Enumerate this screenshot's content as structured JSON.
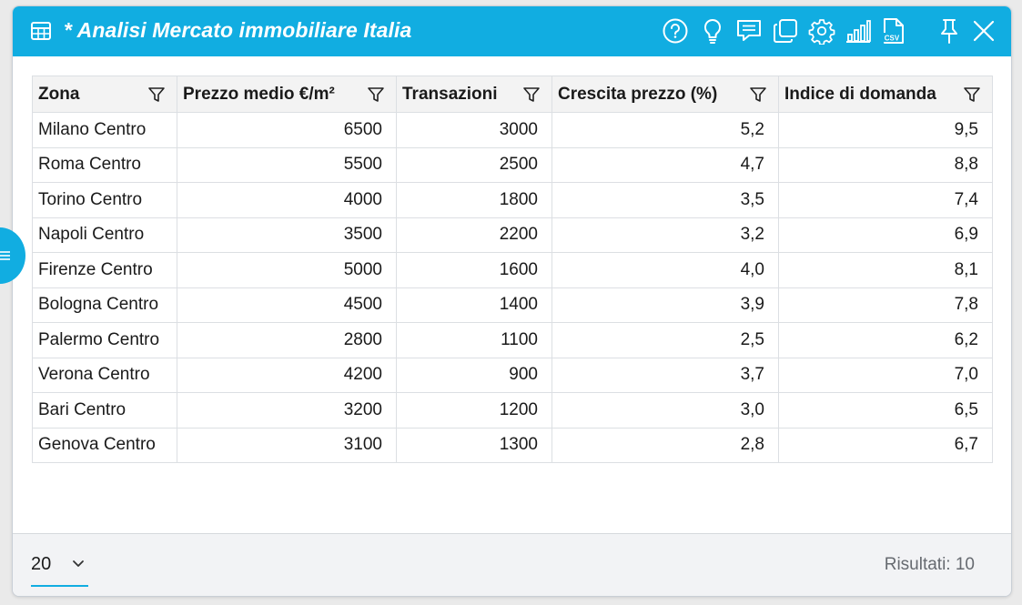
{
  "window": {
    "title": "* Analisi Mercato immobiliare Italia",
    "accent_color": "#11ade1"
  },
  "toolbar": {
    "icons": [
      "help-icon",
      "lightbulb-icon",
      "comment-icon",
      "duplicate-icon",
      "settings-icon",
      "bar-chart-icon",
      "csv-export-icon",
      "pin-icon",
      "close-icon"
    ],
    "csv_label": "CSV"
  },
  "table": {
    "headers": [
      "Zona",
      "Prezzo medio €/m²",
      "Transazioni",
      "Crescita prezzo (%)",
      "Indice di domanda"
    ],
    "rows": [
      [
        "Milano Centro",
        "6500",
        "3000",
        "5,2",
        "9,5"
      ],
      [
        "Roma Centro",
        "5500",
        "2500",
        "4,7",
        "8,8"
      ],
      [
        "Torino Centro",
        "4000",
        "1800",
        "3,5",
        "7,4"
      ],
      [
        "Napoli Centro",
        "3500",
        "2200",
        "3,2",
        "6,9"
      ],
      [
        "Firenze Centro",
        "5000",
        "1600",
        "4,0",
        "8,1"
      ],
      [
        "Bologna Centro",
        "4500",
        "1400",
        "3,9",
        "7,8"
      ],
      [
        "Palermo Centro",
        "2800",
        "1100",
        "2,5",
        "6,2"
      ],
      [
        "Verona Centro",
        "4200",
        "900",
        "3,7",
        "7,0"
      ],
      [
        "Bari Centro",
        "3200",
        "1200",
        "3,0",
        "6,5"
      ],
      [
        "Genova Centro",
        "3100",
        "1300",
        "2,8",
        "6,7"
      ]
    ]
  },
  "footer": {
    "page_size": "20",
    "results": "Risultati: 10"
  }
}
